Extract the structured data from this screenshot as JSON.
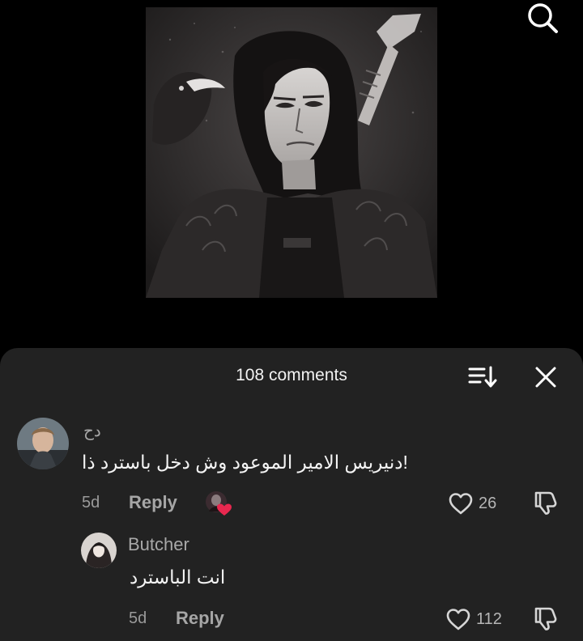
{
  "header": {
    "search_icon": "search-icon"
  },
  "post": {
    "image_icon": "portrait-artwork"
  },
  "comments_panel": {
    "title": "108 comments",
    "sort_icon": "sort-icon",
    "close_icon": "close-icon"
  },
  "comments": [
    {
      "username": "دح",
      "text": "دنيريس الامير الموعود وش دخل باسترد ذا!",
      "age": "5d",
      "reply_label": "Reply",
      "likes": "26",
      "liked_by_creator": true
    }
  ],
  "replies": [
    {
      "username": "Butcher",
      "text": "انت الباسترد",
      "age": "5d",
      "reply_label": "Reply",
      "likes": "112"
    }
  ],
  "colors": {
    "background": "#000000",
    "panel": "#222222",
    "creator_heart": "#e8284f"
  }
}
